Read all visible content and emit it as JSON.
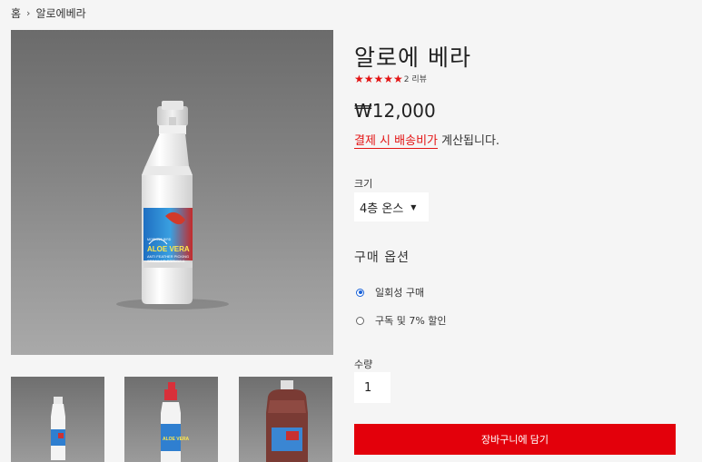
{
  "breadcrumb": {
    "home": "홈",
    "separator": "›",
    "current": "알로에베라"
  },
  "product": {
    "title": "알로에 베라",
    "stars": "★★★★★",
    "rating": 5,
    "review_count": "2 리뷰",
    "price": "₩12,000",
    "shipping_link": "결제 시 배송비가",
    "shipping_suffix": " 계산됩니다."
  },
  "size": {
    "label": "크기",
    "selected": "4층 온스"
  },
  "purchase": {
    "title": "구매 옵션",
    "options": [
      {
        "label": "일회성 구매",
        "checked": true
      },
      {
        "label": "구독 및 7% 할인",
        "checked": false
      }
    ]
  },
  "quantity": {
    "label": "수량",
    "value": "1"
  },
  "cart_button": "장바구니에 담기",
  "bottle_label": {
    "brand": "MORNING BIRD",
    "name": "ALOE VERA",
    "sub1": "ANTI FEATHER PICKING",
    "sub2": "SPRAY AID FORMULA",
    "size": "4 fl. oz"
  },
  "colors": {
    "accent": "#e31414",
    "button": "#e3000b",
    "radio": "#1a62d8"
  }
}
